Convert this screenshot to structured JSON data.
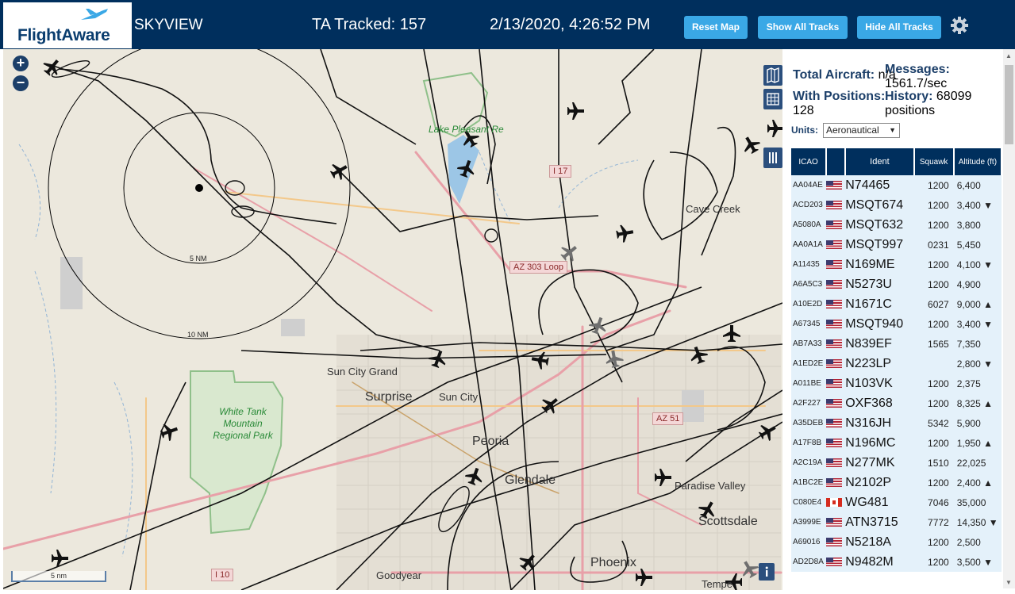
{
  "header": {
    "logo_text": "FlightAware",
    "app_title": "SKYVIEW",
    "tracked": "TA Tracked: 157",
    "datetime": "2/13/2020, 4:26:52 PM",
    "reset_map": "Reset Map",
    "show_all_tracks": "Show All Tracks",
    "hide_all_tracks": "Hide All Tracks",
    "settings_icon": "gear-icon"
  },
  "map": {
    "zoom_in": "+",
    "zoom_out": "−",
    "scale": "5 nm",
    "range_labels": [
      "5 NM",
      "10 NM"
    ],
    "places": [
      "Cave Creek",
      "Sun City Grand",
      "Surprise",
      "Sun City",
      "Peoria",
      "Glendale",
      "Paradise Valley",
      "Scottsdale",
      "Phoenix",
      "Goodyear",
      "Tempe"
    ],
    "parks": [
      "Lake Pleasant Re",
      "White Tank Mountain Regional Park"
    ],
    "shields": [
      "I 17",
      "AZ 303 Loop",
      "AZ 51",
      "I 10"
    ],
    "controls": [
      "map-layers-icon",
      "grid-icon",
      "columns-icon",
      "info-icon"
    ]
  },
  "stats": {
    "total_aircraft_label": "Total Aircraft:",
    "total_aircraft": "n/a",
    "with_positions_label": "With Positions:",
    "with_positions": "128",
    "messages_label": "Messages:",
    "messages": "1561.7/sec",
    "history_label": "History:",
    "history": "68099 positions"
  },
  "units": {
    "label": "Units:",
    "selected": "Aeronautical"
  },
  "table": {
    "columns": [
      "ICAO",
      "",
      "Ident",
      "Squawk",
      "Altitude (ft)"
    ],
    "rows": [
      {
        "icao": "AA04AE",
        "flag": "us",
        "ident": "N74465",
        "squawk": "1200",
        "alt": "6,400"
      },
      {
        "icao": "ACD203",
        "flag": "us",
        "ident": "MSQT674",
        "squawk": "1200",
        "alt": "3,400 ▼"
      },
      {
        "icao": "A5080A",
        "flag": "us",
        "ident": "MSQT632",
        "squawk": "1200",
        "alt": "3,800"
      },
      {
        "icao": "AA0A1A",
        "flag": "us",
        "ident": "MSQT997",
        "squawk": "0231",
        "alt": "5,450"
      },
      {
        "icao": "A11435",
        "flag": "us",
        "ident": "N169ME",
        "squawk": "1200",
        "alt": "4,100 ▼"
      },
      {
        "icao": "A6A5C3",
        "flag": "us",
        "ident": "N5273U",
        "squawk": "1200",
        "alt": "4,900"
      },
      {
        "icao": "A10E2D",
        "flag": "us",
        "ident": "N1671C",
        "squawk": "6027",
        "alt": "9,000 ▲"
      },
      {
        "icao": "A67345",
        "flag": "us",
        "ident": "MSQT940",
        "squawk": "1200",
        "alt": "3,400 ▼"
      },
      {
        "icao": "AB7A33",
        "flag": "us",
        "ident": "N839EF",
        "squawk": "1565",
        "alt": "7,350"
      },
      {
        "icao": "A1ED2E",
        "flag": "us",
        "ident": "N223LP",
        "squawk": "",
        "alt": "2,800 ▼"
      },
      {
        "icao": "A011BE",
        "flag": "us",
        "ident": "N103VK",
        "squawk": "1200",
        "alt": "2,375"
      },
      {
        "icao": "A2F227",
        "flag": "us",
        "ident": "OXF368",
        "squawk": "1200",
        "alt": "8,325 ▲"
      },
      {
        "icao": "A35DEB",
        "flag": "us",
        "ident": "N316JH",
        "squawk": "5342",
        "alt": "5,900"
      },
      {
        "icao": "A17F8B",
        "flag": "us",
        "ident": "N196MC",
        "squawk": "1200",
        "alt": "1,950 ▲"
      },
      {
        "icao": "A2C19A",
        "flag": "us",
        "ident": "N277MK",
        "squawk": "1510",
        "alt": "22,025"
      },
      {
        "icao": "A1BC2E",
        "flag": "us",
        "ident": "N2102P",
        "squawk": "1200",
        "alt": "2,400 ▲"
      },
      {
        "icao": "C080E4",
        "flag": "ca",
        "ident": "WG481",
        "squawk": "7046",
        "alt": "35,000"
      },
      {
        "icao": "A3999E",
        "flag": "us",
        "ident": "ATN3715",
        "squawk": "7772",
        "alt": "14,350 ▼"
      },
      {
        "icao": "A69016",
        "flag": "us",
        "ident": "N5218A",
        "squawk": "1200",
        "alt": "2,500"
      },
      {
        "icao": "AD2D8A",
        "flag": "us",
        "ident": "N9482M",
        "squawk": "1200",
        "alt": "3,500 ▼"
      }
    ]
  }
}
